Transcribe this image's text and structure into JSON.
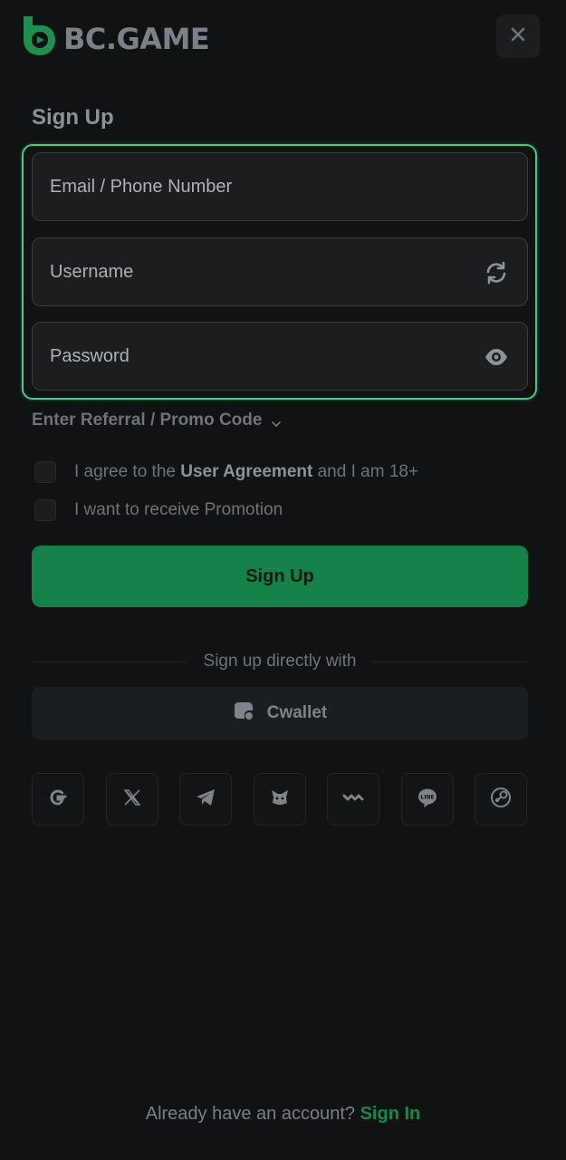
{
  "header": {
    "brand": "BC.GAME",
    "logo_icon": "bc-game-logo-icon",
    "close_icon": "close-icon"
  },
  "form": {
    "title": "Sign Up",
    "email": {
      "placeholder": "Email / Phone Number"
    },
    "username": {
      "placeholder": "Username",
      "icon": "refresh-icon"
    },
    "password": {
      "placeholder": "Password",
      "icon": "eye-icon"
    },
    "referral_label": "Enter Referral / Promo Code",
    "agree": {
      "prefix": "I agree to the",
      "link": "User Agreement",
      "suffix": "and I am 18+"
    },
    "promotion_label": "I want to receive Promotion",
    "submit_label": "Sign Up"
  },
  "alt_signup": {
    "divider_text": "Sign up directly with",
    "cwallet_label": "Cwallet",
    "socials": [
      "google-icon",
      "x-icon",
      "telegram-icon",
      "metamask-icon",
      "walletconnect-icon",
      "line-icon",
      "steam-icon"
    ]
  },
  "footer": {
    "prompt": "Already have an account?",
    "link": "Sign In"
  },
  "colors": {
    "accent": "#3fce82",
    "button": "#148148",
    "background": "#111213"
  }
}
